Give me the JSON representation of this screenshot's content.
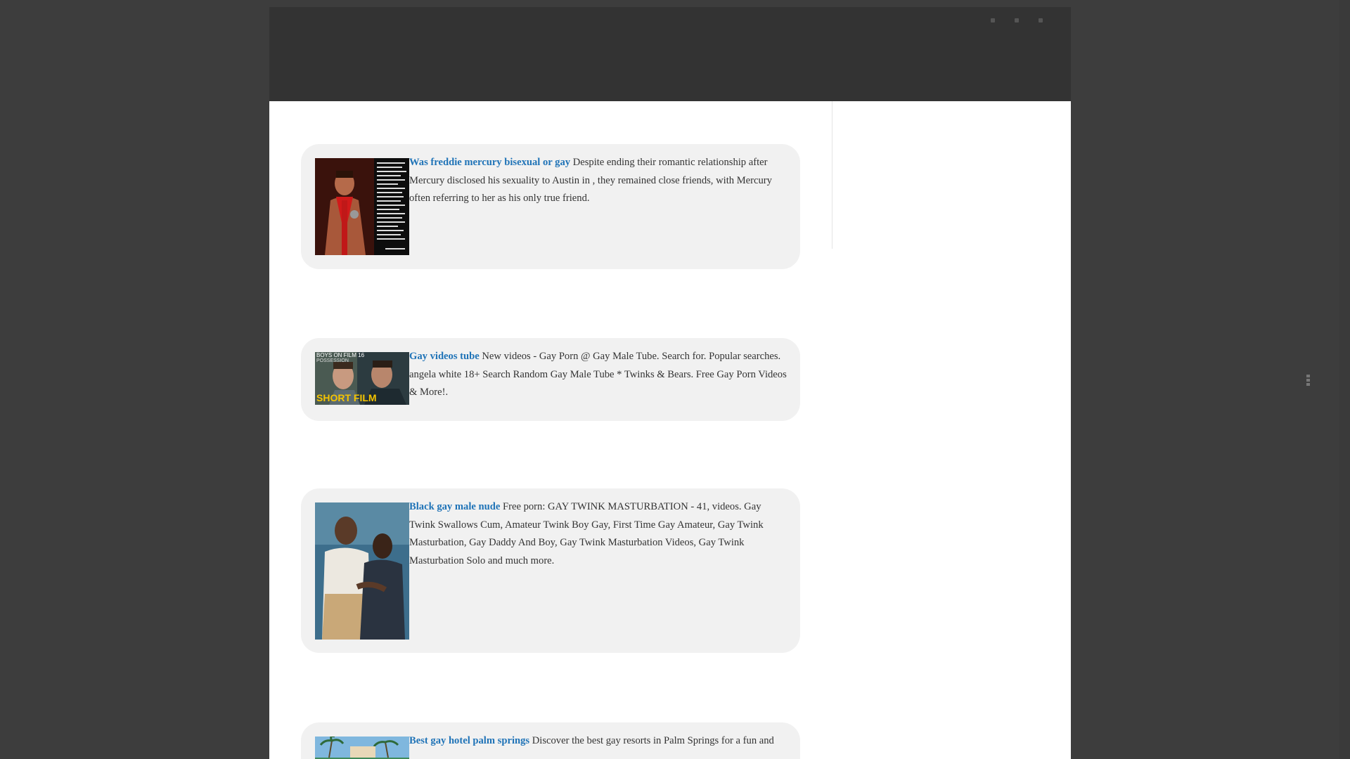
{
  "header": {
    "menu_dots": [
      "dot-1",
      "dot-2",
      "dot-3"
    ]
  },
  "articles": [
    {
      "title": "Was freddie mercury bisexual or gay",
      "description": "Despite ending their romantic relationship after Mercury disclosed his sexuality to Austin in , they remained close friends, with Mercury often referring to her as his only true friend."
    },
    {
      "title": "Gay videos tube",
      "description": "New videos - Gay Porn @ Gay Male Tube. Search for. Popular searches. angela white 18+ Search Random Gay Male Tube * Twinks & Bears. Free Gay Porn Videos & More!.",
      "thumb_caption_top": "BOYS ON FILM 16",
      "thumb_caption_sub": "POSSESSION",
      "thumb_caption_main": "SHORT FILM"
    },
    {
      "title": "Black gay male nude",
      "description": "Free porn: GAY TWINK MASTURBATION - 41, videos. Gay Twink Swallows Cum, Amateur Twink Boy Gay, First Time Gay Amateur, Gay Twink Masturbation, Gay Daddy And Boy, Gay Twink Masturbation Videos, Gay Twink Masturbation Solo and much more."
    },
    {
      "title": "Best gay hotel palm springs",
      "description": "Discover the best gay resorts in Palm Springs for a fun and"
    }
  ],
  "colors": {
    "link": "#1f73b7",
    "header_bg": "#333333",
    "card_bg": "#f1f1f1"
  }
}
